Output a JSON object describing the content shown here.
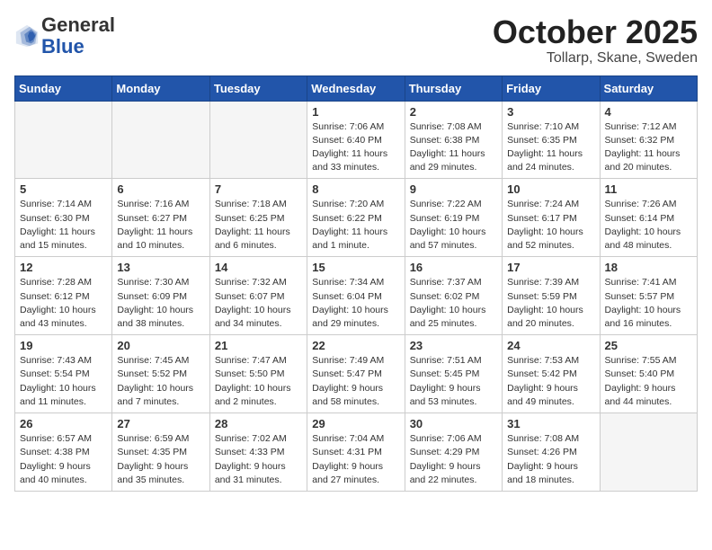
{
  "header": {
    "logo_general": "General",
    "logo_blue": "Blue",
    "month_title": "October 2025",
    "location": "Tollarp, Skane, Sweden"
  },
  "weekdays": [
    "Sunday",
    "Monday",
    "Tuesday",
    "Wednesday",
    "Thursday",
    "Friday",
    "Saturday"
  ],
  "weeks": [
    [
      {
        "day": "",
        "info": ""
      },
      {
        "day": "",
        "info": ""
      },
      {
        "day": "",
        "info": ""
      },
      {
        "day": "1",
        "info": "Sunrise: 7:06 AM\nSunset: 6:40 PM\nDaylight: 11 hours\nand 33 minutes."
      },
      {
        "day": "2",
        "info": "Sunrise: 7:08 AM\nSunset: 6:38 PM\nDaylight: 11 hours\nand 29 minutes."
      },
      {
        "day": "3",
        "info": "Sunrise: 7:10 AM\nSunset: 6:35 PM\nDaylight: 11 hours\nand 24 minutes."
      },
      {
        "day": "4",
        "info": "Sunrise: 7:12 AM\nSunset: 6:32 PM\nDaylight: 11 hours\nand 20 minutes."
      }
    ],
    [
      {
        "day": "5",
        "info": "Sunrise: 7:14 AM\nSunset: 6:30 PM\nDaylight: 11 hours\nand 15 minutes."
      },
      {
        "day": "6",
        "info": "Sunrise: 7:16 AM\nSunset: 6:27 PM\nDaylight: 11 hours\nand 10 minutes."
      },
      {
        "day": "7",
        "info": "Sunrise: 7:18 AM\nSunset: 6:25 PM\nDaylight: 11 hours\nand 6 minutes."
      },
      {
        "day": "8",
        "info": "Sunrise: 7:20 AM\nSunset: 6:22 PM\nDaylight: 11 hours\nand 1 minute."
      },
      {
        "day": "9",
        "info": "Sunrise: 7:22 AM\nSunset: 6:19 PM\nDaylight: 10 hours\nand 57 minutes."
      },
      {
        "day": "10",
        "info": "Sunrise: 7:24 AM\nSunset: 6:17 PM\nDaylight: 10 hours\nand 52 minutes."
      },
      {
        "day": "11",
        "info": "Sunrise: 7:26 AM\nSunset: 6:14 PM\nDaylight: 10 hours\nand 48 minutes."
      }
    ],
    [
      {
        "day": "12",
        "info": "Sunrise: 7:28 AM\nSunset: 6:12 PM\nDaylight: 10 hours\nand 43 minutes."
      },
      {
        "day": "13",
        "info": "Sunrise: 7:30 AM\nSunset: 6:09 PM\nDaylight: 10 hours\nand 38 minutes."
      },
      {
        "day": "14",
        "info": "Sunrise: 7:32 AM\nSunset: 6:07 PM\nDaylight: 10 hours\nand 34 minutes."
      },
      {
        "day": "15",
        "info": "Sunrise: 7:34 AM\nSunset: 6:04 PM\nDaylight: 10 hours\nand 29 minutes."
      },
      {
        "day": "16",
        "info": "Sunrise: 7:37 AM\nSunset: 6:02 PM\nDaylight: 10 hours\nand 25 minutes."
      },
      {
        "day": "17",
        "info": "Sunrise: 7:39 AM\nSunset: 5:59 PM\nDaylight: 10 hours\nand 20 minutes."
      },
      {
        "day": "18",
        "info": "Sunrise: 7:41 AM\nSunset: 5:57 PM\nDaylight: 10 hours\nand 16 minutes."
      }
    ],
    [
      {
        "day": "19",
        "info": "Sunrise: 7:43 AM\nSunset: 5:54 PM\nDaylight: 10 hours\nand 11 minutes."
      },
      {
        "day": "20",
        "info": "Sunrise: 7:45 AM\nSunset: 5:52 PM\nDaylight: 10 hours\nand 7 minutes."
      },
      {
        "day": "21",
        "info": "Sunrise: 7:47 AM\nSunset: 5:50 PM\nDaylight: 10 hours\nand 2 minutes."
      },
      {
        "day": "22",
        "info": "Sunrise: 7:49 AM\nSunset: 5:47 PM\nDaylight: 9 hours\nand 58 minutes."
      },
      {
        "day": "23",
        "info": "Sunrise: 7:51 AM\nSunset: 5:45 PM\nDaylight: 9 hours\nand 53 minutes."
      },
      {
        "day": "24",
        "info": "Sunrise: 7:53 AM\nSunset: 5:42 PM\nDaylight: 9 hours\nand 49 minutes."
      },
      {
        "day": "25",
        "info": "Sunrise: 7:55 AM\nSunset: 5:40 PM\nDaylight: 9 hours\nand 44 minutes."
      }
    ],
    [
      {
        "day": "26",
        "info": "Sunrise: 6:57 AM\nSunset: 4:38 PM\nDaylight: 9 hours\nand 40 minutes."
      },
      {
        "day": "27",
        "info": "Sunrise: 6:59 AM\nSunset: 4:35 PM\nDaylight: 9 hours\nand 35 minutes."
      },
      {
        "day": "28",
        "info": "Sunrise: 7:02 AM\nSunset: 4:33 PM\nDaylight: 9 hours\nand 31 minutes."
      },
      {
        "day": "29",
        "info": "Sunrise: 7:04 AM\nSunset: 4:31 PM\nDaylight: 9 hours\nand 27 minutes."
      },
      {
        "day": "30",
        "info": "Sunrise: 7:06 AM\nSunset: 4:29 PM\nDaylight: 9 hours\nand 22 minutes."
      },
      {
        "day": "31",
        "info": "Sunrise: 7:08 AM\nSunset: 4:26 PM\nDaylight: 9 hours\nand 18 minutes."
      },
      {
        "day": "",
        "info": ""
      }
    ]
  ]
}
